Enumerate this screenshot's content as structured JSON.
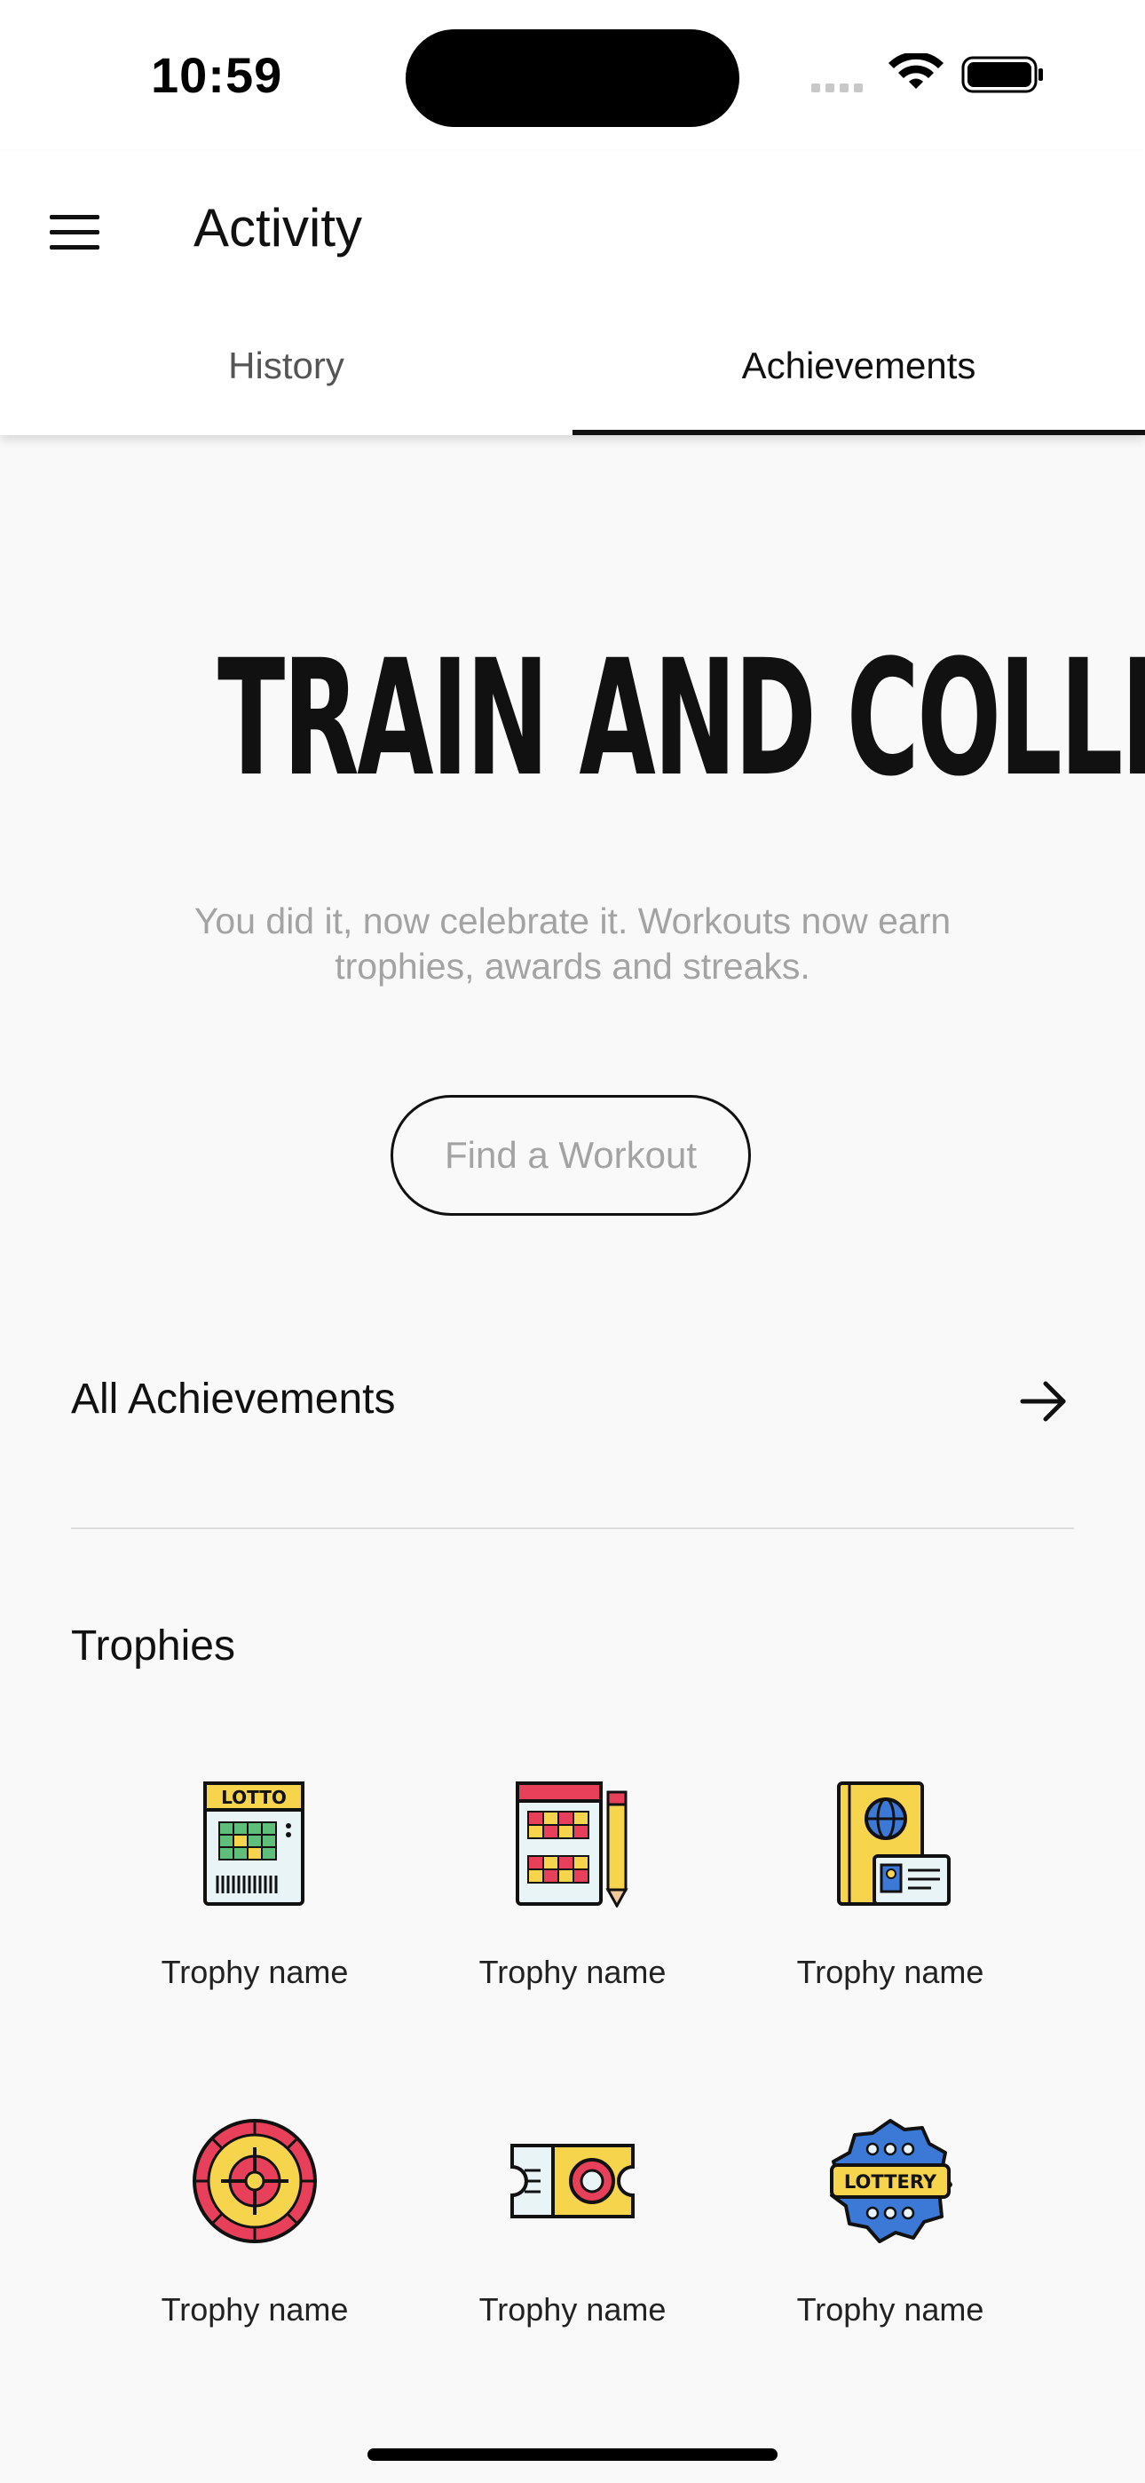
{
  "status_bar": {
    "time": "10:59"
  },
  "header": {
    "title": "Activity",
    "menu_icon": "hamburger-menu-icon",
    "tabs": [
      {
        "label": "History",
        "active": false
      },
      {
        "label": "Achievements",
        "active": true
      }
    ]
  },
  "hero": {
    "title": "TRAIN AND COLLECT",
    "subtitle": "You did it, now celebrate it. Workouts now earn trophies, awards and streaks.",
    "button_label": "Find a Workout"
  },
  "all_achievements": {
    "label": "All Achievements",
    "icon": "arrow-right-icon"
  },
  "trophies": {
    "title": "Trophies",
    "items": [
      {
        "name": "Trophy name",
        "icon": "lotto-ticket-icon",
        "icon_text": "LOTTO"
      },
      {
        "name": "Trophy name",
        "icon": "bingo-card-pencil-icon"
      },
      {
        "name": "Trophy name",
        "icon": "passport-id-card-icon"
      },
      {
        "name": "Trophy name",
        "icon": "roulette-wheel-icon"
      },
      {
        "name": "Trophy name",
        "icon": "ticket-icon"
      },
      {
        "name": "Trophy name",
        "icon": "lottery-badge-icon",
        "icon_text": "LOTTERY"
      }
    ]
  },
  "colors": {
    "background": "#f9f9f9",
    "header_background": "#ffffff",
    "primary_text": "#111111",
    "muted_text": "#a3a3a3",
    "icon_yellow": "#f6d44c",
    "icon_red": "#e8405a",
    "icon_blue": "#3c79d6",
    "icon_green": "#5fbe7a"
  }
}
